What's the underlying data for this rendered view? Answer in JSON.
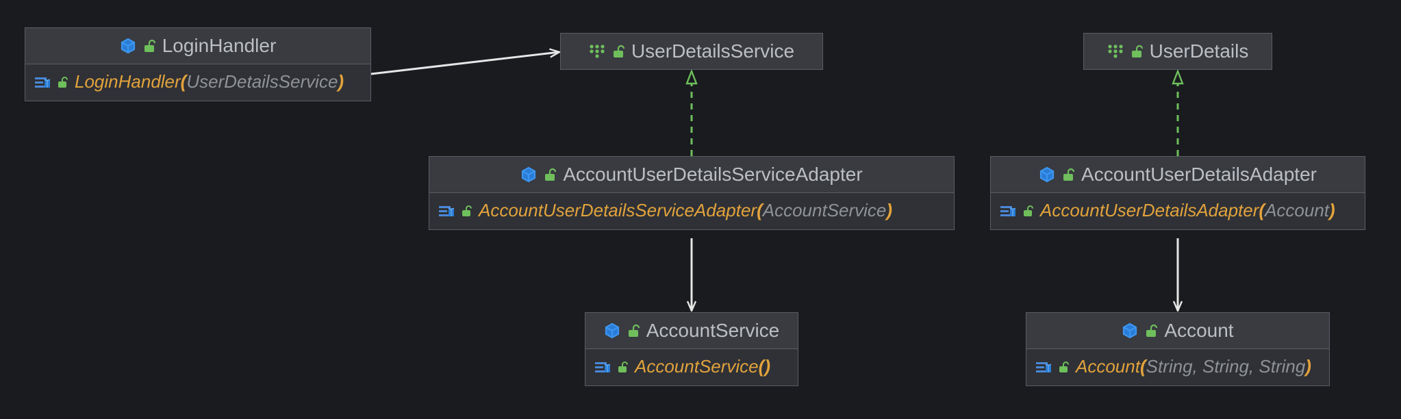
{
  "nodes": {
    "loginHandler": {
      "title": "LoginHandler",
      "type": "class",
      "ctor": {
        "name": "LoginHandler",
        "params": [
          "UserDetailsService"
        ]
      }
    },
    "userDetailsService": {
      "title": "UserDetailsService",
      "type": "interface"
    },
    "userDetails": {
      "title": "UserDetails",
      "type": "interface"
    },
    "accountUserDetailsServiceAdapter": {
      "title": "AccountUserDetailsServiceAdapter",
      "type": "class",
      "ctor": {
        "name": "AccountUserDetailsServiceAdapter",
        "params": [
          "AccountService"
        ]
      }
    },
    "accountUserDetailsAdapter": {
      "title": "AccountUserDetailsAdapter",
      "type": "class",
      "ctor": {
        "name": "AccountUserDetailsAdapter",
        "params": [
          "Account"
        ]
      }
    },
    "accountService": {
      "title": "AccountService",
      "type": "class",
      "ctor": {
        "name": "AccountService",
        "params": []
      }
    },
    "account": {
      "title": "Account",
      "type": "class",
      "ctor": {
        "name": "Account",
        "params": [
          "String",
          "String",
          "String"
        ]
      }
    }
  },
  "edges": [
    {
      "from": "loginHandler",
      "to": "userDetailsService",
      "kind": "association"
    },
    {
      "from": "accountUserDetailsServiceAdapter",
      "to": "userDetailsService",
      "kind": "realization"
    },
    {
      "from": "accountUserDetailsServiceAdapter",
      "to": "accountService",
      "kind": "association"
    },
    {
      "from": "accountUserDetailsAdapter",
      "to": "userDetails",
      "kind": "realization"
    },
    {
      "from": "accountUserDetailsAdapter",
      "to": "account",
      "kind": "association"
    }
  ],
  "colors": {
    "bg": "#191b1f",
    "nodeBg": "#2f3136",
    "titleBg": "#393b40",
    "border": "#5a5d63",
    "text": "#bcbfc4",
    "ctor": "#e3a33c",
    "param": "#8f9297",
    "iconBlue": "#3d95f0",
    "iconGreen": "#6fbf5c",
    "lockGreen": "#6fbf5c",
    "arrowWhite": "#e6e6e6",
    "arrowGreen": "#6fbf5c"
  }
}
